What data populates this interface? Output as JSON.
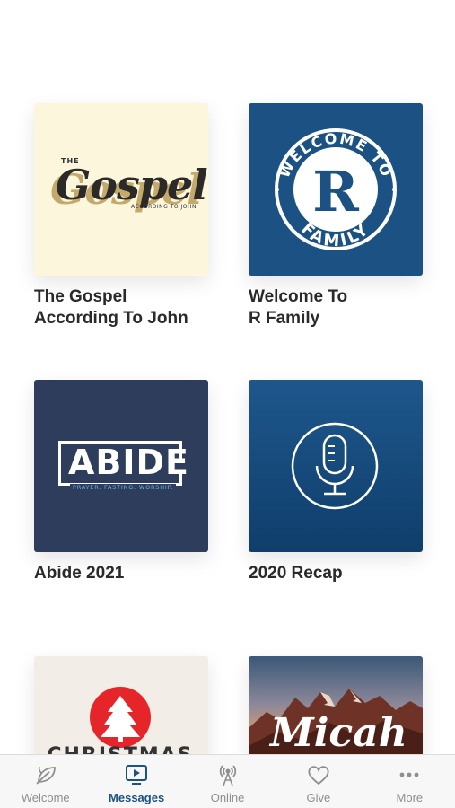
{
  "status_bar": {
    "clock": ""
  },
  "series": [
    {
      "title": "The Gospel\nAccording To John",
      "art": {
        "the": "THE",
        "word": "Gospel",
        "sub": "ACCORDING TO JOHN"
      }
    },
    {
      "title": "Welcome To\nR Family",
      "art": {
        "top_text": "WELCOME TO",
        "letter": "R",
        "bottom_text": "FAMILY"
      }
    },
    {
      "title": "Abide 2021",
      "art": {
        "word": "ABIDE",
        "tagline": "PRAYER. FASTING. WORSHIP."
      }
    },
    {
      "title": "2020 Recap",
      "art": {
        "icon": "microphone-icon"
      }
    },
    {
      "title": "",
      "art": {
        "icon": "christmas-tree-icon",
        "partial_text": "CHRISTMAS"
      }
    },
    {
      "title": "",
      "art": {
        "word": "Micah"
      }
    }
  ],
  "tabbar": {
    "items": [
      {
        "label": "Welcome",
        "icon": "leaf-icon",
        "active": false
      },
      {
        "label": "Messages",
        "icon": "play-screen-icon",
        "active": true
      },
      {
        "label": "Online",
        "icon": "broadcast-icon",
        "active": false
      },
      {
        "label": "Give",
        "icon": "heart-icon",
        "active": false
      },
      {
        "label": "More",
        "icon": "more-dots-icon",
        "active": false
      }
    ]
  },
  "colors": {
    "accent": "#1c5283",
    "tab_inactive": "#8e8e8e",
    "title_text": "#2a2a2a"
  }
}
